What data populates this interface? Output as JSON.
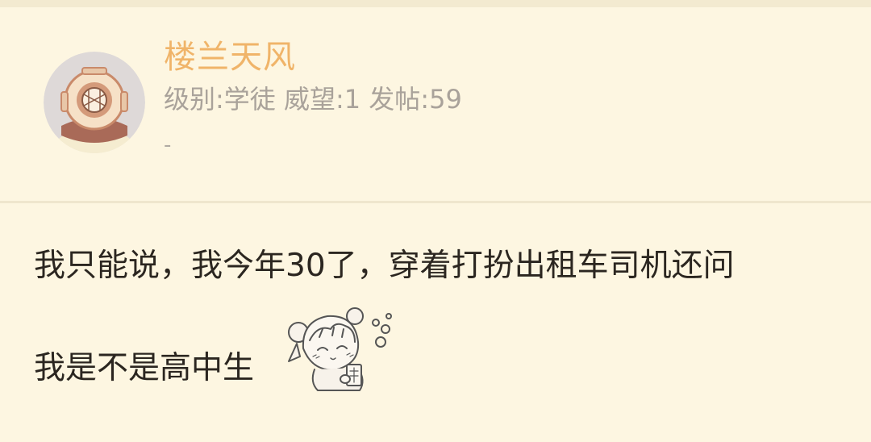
{
  "user": {
    "name": "楼兰天风",
    "level": "级别:学徒",
    "prestige": "威望:1",
    "posts": "发帖:59",
    "signature": "-"
  },
  "post": {
    "line1": "我只能说，我今年30了，穿着打扮出租车司机还问",
    "line2": "我是不是高中生"
  },
  "icons": {
    "avatar": "diving-helmet-avatar",
    "sticker": "chibi-girl-sticker"
  },
  "colors": {
    "background": "#fdf6e1",
    "username": "#f0b469",
    "meta": "#a9a29a",
    "text": "#2b2620"
  }
}
